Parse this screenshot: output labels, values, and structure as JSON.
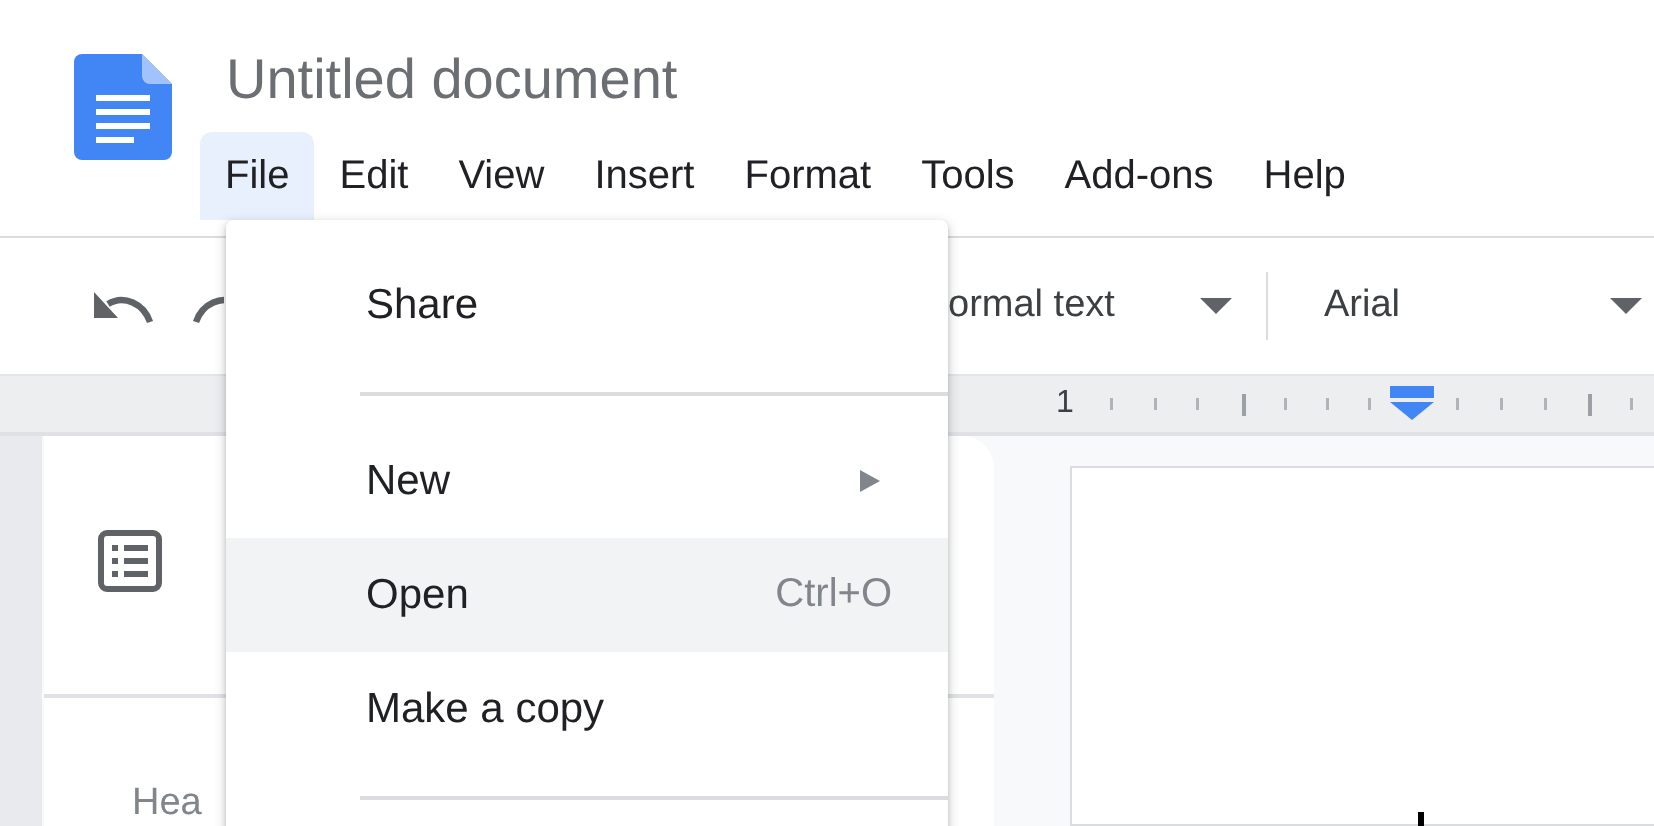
{
  "document": {
    "title": "Untitled document"
  },
  "menu_bar": [
    {
      "label": "File",
      "selected": true
    },
    {
      "label": "Edit",
      "selected": false
    },
    {
      "label": "View",
      "selected": false
    },
    {
      "label": "Insert",
      "selected": false
    },
    {
      "label": "Format",
      "selected": false
    },
    {
      "label": "Tools",
      "selected": false
    },
    {
      "label": "Add-ons",
      "selected": false
    },
    {
      "label": "Help",
      "selected": false
    }
  ],
  "toolbar": {
    "style_dropdown": "ormal text",
    "font_dropdown": "Arial"
  },
  "ruler": {
    "label": "1"
  },
  "outline_panel": {
    "heading_hint": "Hea"
  },
  "file_menu": {
    "items": [
      {
        "kind": "item",
        "label": "Share",
        "highlighted": false
      },
      {
        "kind": "divider"
      },
      {
        "kind": "submenu",
        "label": "New",
        "highlighted": false
      },
      {
        "kind": "item",
        "label": "Open",
        "shortcut": "Ctrl+O",
        "highlighted": true
      },
      {
        "kind": "item",
        "label": "Make a copy",
        "highlighted": false
      },
      {
        "kind": "divider"
      }
    ]
  }
}
